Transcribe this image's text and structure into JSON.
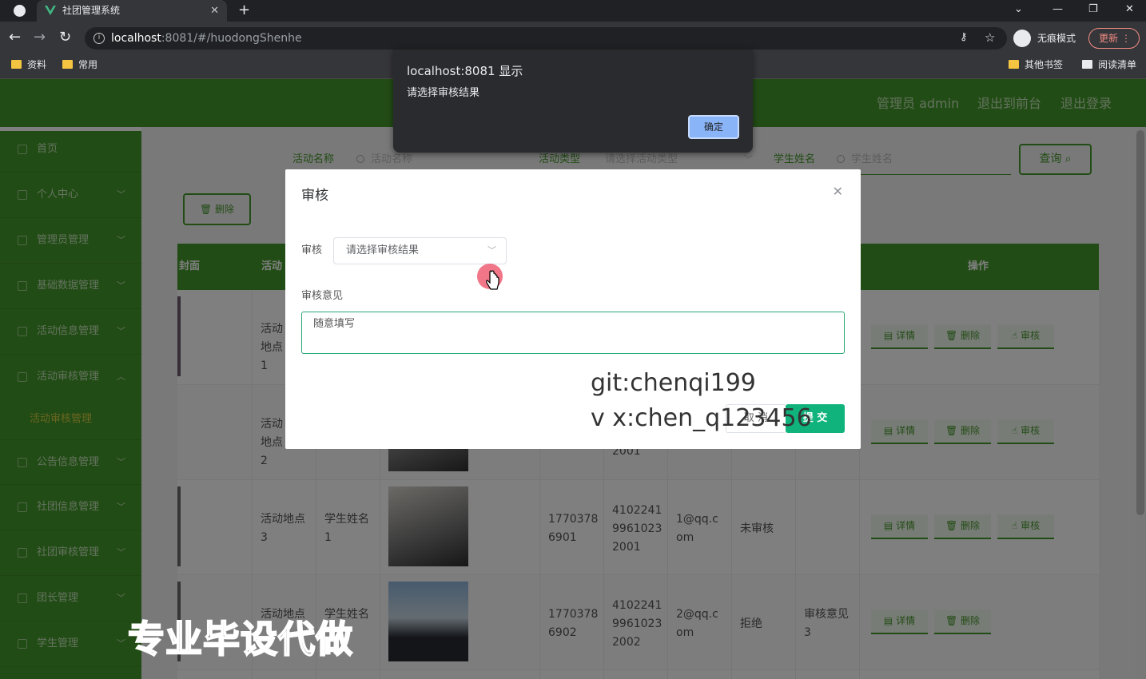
{
  "browser": {
    "tab_title": "社团管理系统",
    "url_host": "localhost",
    "url_rest": ":8081/#/huodongShenhe",
    "incognito_label": "无痕模式",
    "update_label": "更新",
    "bookmarks": [
      "资料",
      "常用"
    ],
    "bookmarks_right": [
      "其他书签",
      "阅读清单"
    ]
  },
  "alert": {
    "title": "localhost:8081 显示",
    "message": "请选择审核结果",
    "ok_label": "确定"
  },
  "header": {
    "admin_label": "管理员 admin",
    "front_label": "退出到前台",
    "logout_label": "退出登录"
  },
  "sidebar": {
    "items": [
      "首页",
      "个人中心",
      "管理员管理",
      "基础数据管理",
      "活动信息管理",
      "活动审核管理",
      "公告信息管理",
      "社团信息管理",
      "社团审核管理",
      "团长管理",
      "学生管理"
    ],
    "subitem": "活动审核管理"
  },
  "filters": {
    "name_label": "活动名称",
    "name_placeholder": "活动名称",
    "type_label": "活动类型",
    "type_placeholder": "请选择活动类型",
    "student_label": "学生姓名",
    "student_placeholder": "学生姓名",
    "query_label": "查询"
  },
  "toolbar": {
    "delete_label": "删除"
  },
  "table": {
    "headers": {
      "cover": "封面",
      "activity": "活动",
      "ops": "操作"
    },
    "rows": [
      {
        "place": "活动地点1",
        "student": "",
        "phone": "",
        "idcard": "",
        "email": "",
        "status": "",
        "opinion": "",
        "actions": [
          "详情",
          "删除",
          "审核"
        ]
      },
      {
        "place": "活动地点2",
        "student": "",
        "phone": "",
        "idcard": "2001",
        "email": "",
        "status": "",
        "opinion": "",
        "actions": [
          "详情",
          "删除",
          "审核"
        ]
      },
      {
        "place": "活动地点3",
        "student": "学生姓名1",
        "phone": "17703786901",
        "idcard": "410224199610232001",
        "email": "1@qq.com",
        "status": "未审核",
        "opinion": "",
        "actions": [
          "详情",
          "删除",
          "审核"
        ]
      },
      {
        "place": "活动地点",
        "student": "学生姓名",
        "phone": "17703786902",
        "idcard": "410224199610232002",
        "email": "2@qq.com",
        "status": "拒绝",
        "opinion": "审核意见3",
        "actions": [
          "详情",
          "删除"
        ]
      }
    ]
  },
  "dialog": {
    "title": "审核",
    "audit_label": "审核",
    "select_placeholder": "请选择审核结果",
    "opinion_label": "审核意见",
    "opinion_value": "随意填写",
    "cancel_label": "取 消",
    "submit_label": "提 交"
  },
  "watermarks": {
    "git": "git:chenqi199",
    "vx": "v x:chen_q123456",
    "promo": "专业毕设代做"
  }
}
